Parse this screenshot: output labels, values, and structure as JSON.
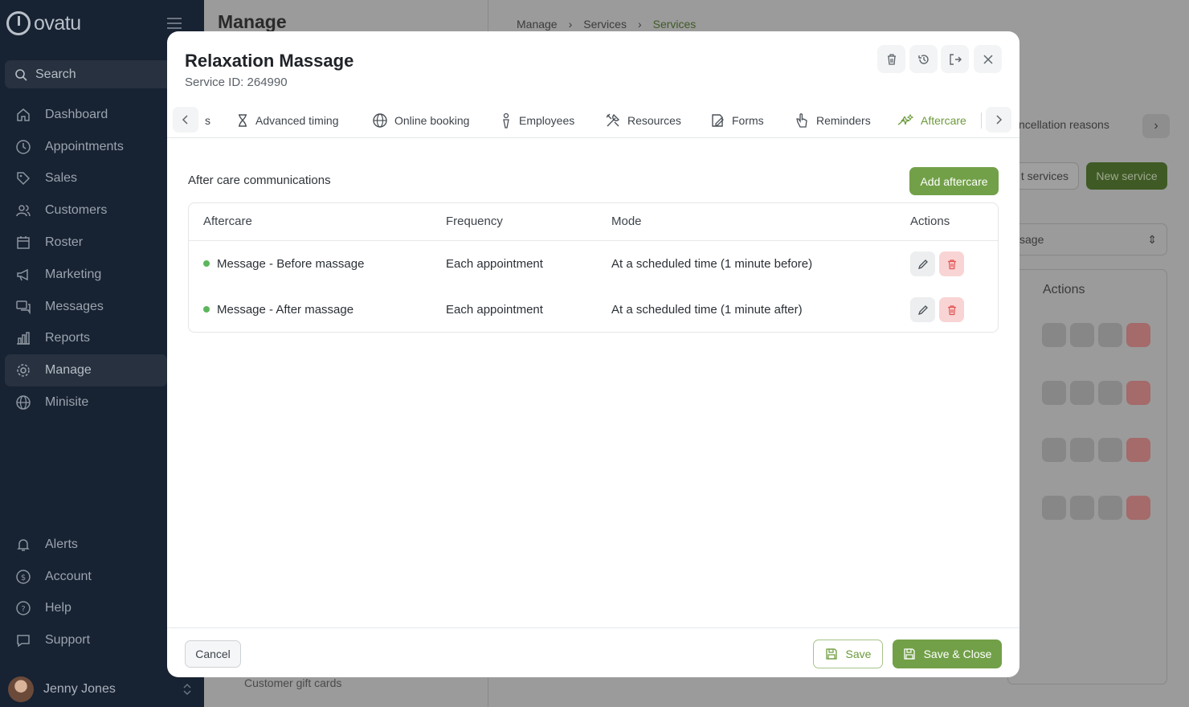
{
  "sidebar": {
    "logo": "ovatu",
    "search": "Search",
    "nav": [
      {
        "label": "Dashboard",
        "icon": "home-icon"
      },
      {
        "label": "Appointments",
        "icon": "clock-icon"
      },
      {
        "label": "Sales",
        "icon": "tag-icon"
      },
      {
        "label": "Customers",
        "icon": "users-icon"
      },
      {
        "label": "Roster",
        "icon": "calendar-icon"
      },
      {
        "label": "Marketing",
        "icon": "megaphone-icon"
      },
      {
        "label": "Messages",
        "icon": "messages-icon"
      },
      {
        "label": "Reports",
        "icon": "chart-icon"
      },
      {
        "label": "Manage",
        "icon": "gear-icon",
        "active": true
      },
      {
        "label": "Minisite",
        "icon": "globe-icon"
      }
    ],
    "bottom_nav": [
      {
        "label": "Alerts",
        "icon": "bell-icon"
      },
      {
        "label": "Account",
        "icon": "dollar-icon"
      },
      {
        "label": "Help",
        "icon": "help-icon"
      },
      {
        "label": "Support",
        "icon": "chat-icon"
      }
    ],
    "user": "Jenny Jones"
  },
  "background": {
    "page_title": "Manage",
    "breadcrumb": [
      "Manage",
      "Services",
      "Services"
    ],
    "tab_partial": "ncellation reasons",
    "btn_services": "t services",
    "btn_new_service": "New service",
    "select_value": "sage",
    "actions_header": "Actions",
    "gift_cards": "Customer gift cards"
  },
  "modal": {
    "title": "Relaxation Massage",
    "service_id": "Service ID: 264990",
    "tab_partial": "s",
    "tabs": [
      {
        "label": "Advanced timing",
        "icon": "hourglass-icon"
      },
      {
        "label": "Online booking",
        "icon": "globe-icon"
      },
      {
        "label": "Employees",
        "icon": "person-icon"
      },
      {
        "label": "Resources",
        "icon": "tools-icon"
      },
      {
        "label": "Forms",
        "icon": "form-icon"
      },
      {
        "label": "Reminders",
        "icon": "hand-icon"
      },
      {
        "label": "Aftercare",
        "icon": "sparkle-icon",
        "active": true
      }
    ],
    "section_title": "After care communications",
    "add_button": "Add aftercare",
    "table": {
      "headers": [
        "Aftercare",
        "Frequency",
        "Mode",
        "Actions"
      ],
      "rows": [
        {
          "aftercare": "Message - Before massage",
          "frequency": "Each appointment",
          "mode": "At a scheduled time (1 minute before)"
        },
        {
          "aftercare": "Message - After massage",
          "frequency": "Each appointment",
          "mode": "At a scheduled time (1 minute after)"
        }
      ]
    },
    "footer": {
      "cancel": "Cancel",
      "save": "Save",
      "save_close": "Save & Close"
    }
  },
  "colors": {
    "sidebar_bg": "#172232",
    "accent_green": "#72a048",
    "active_tab": "#6c9a3c",
    "delete_bg": "#f9d4d4",
    "status_dot": "#5db65d"
  }
}
